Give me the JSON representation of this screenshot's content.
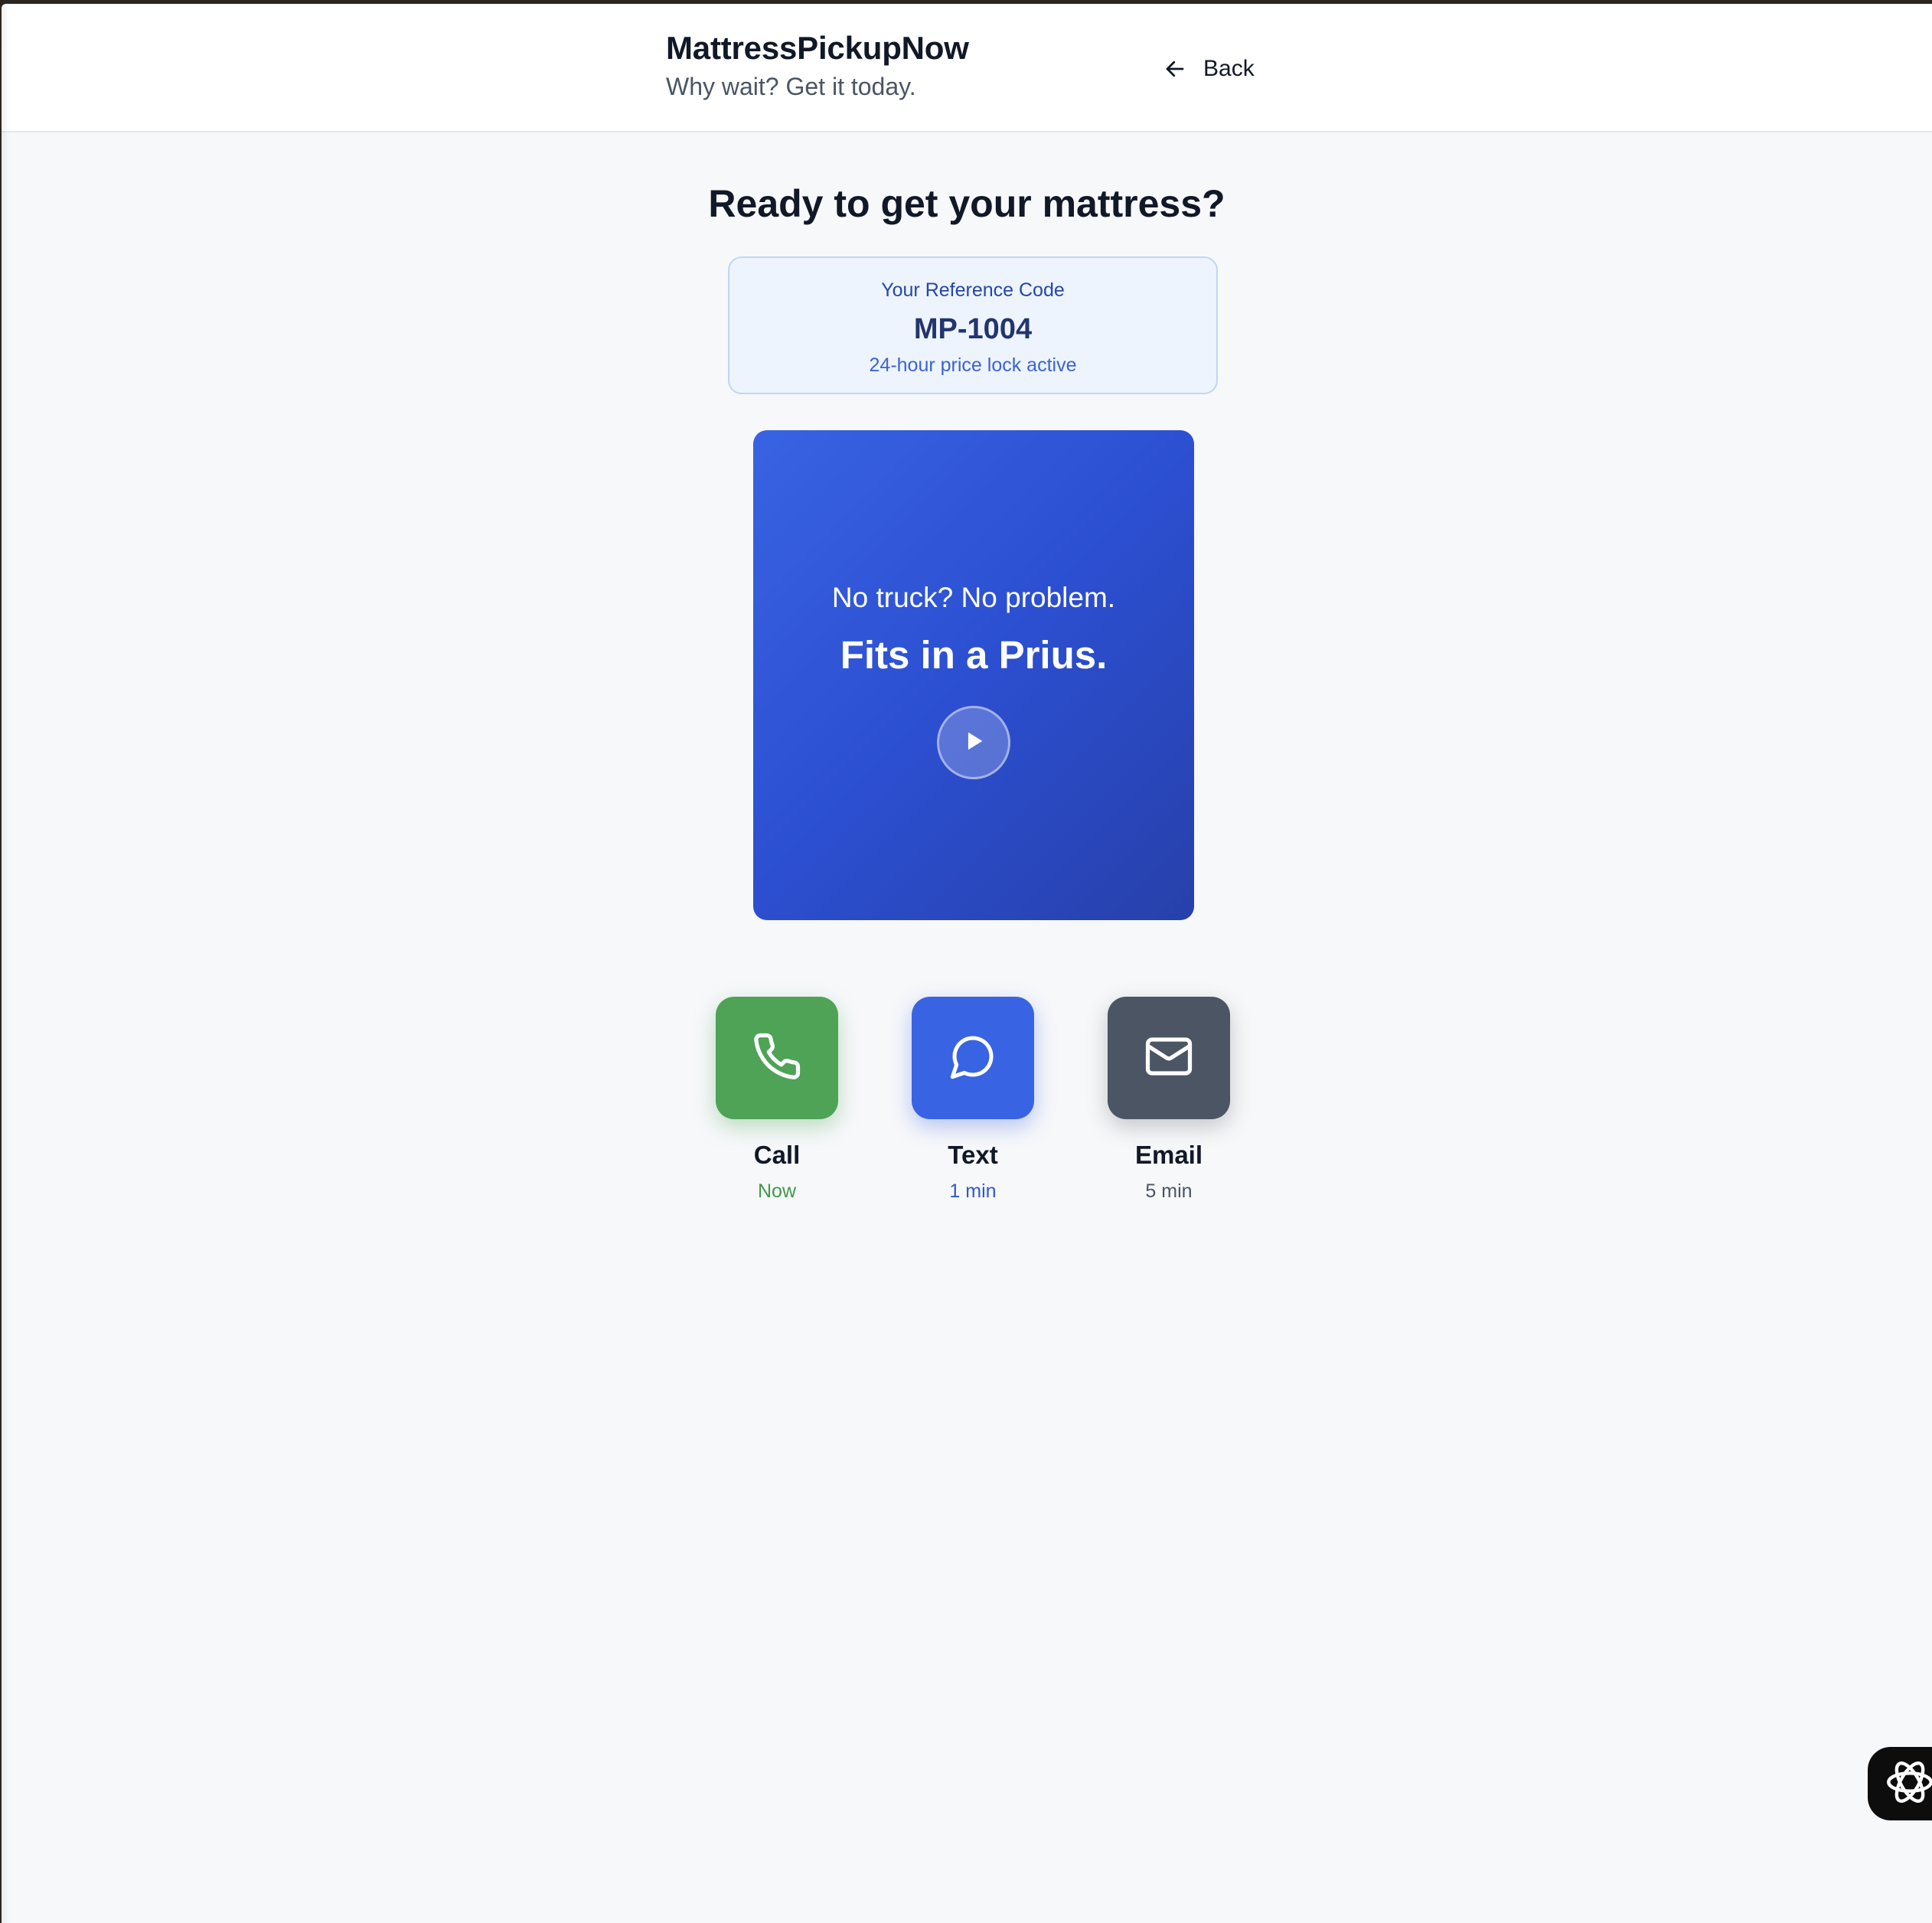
{
  "header": {
    "brand": "MattressPickupNow",
    "tagline": "Why wait? Get it today.",
    "back_label": "Back"
  },
  "main": {
    "title": "Ready to get your mattress?",
    "reference": {
      "label": "Your Reference Code",
      "code": "MP-1004",
      "note": "24-hour price lock active"
    },
    "video": {
      "line1": "No truck? No problem.",
      "line2": "Fits in a Prius.",
      "play_icon": "play-icon"
    },
    "contacts": [
      {
        "label": "Call",
        "eta": "Now",
        "icon": "phone-icon",
        "color": "#4ea356"
      },
      {
        "label": "Text",
        "eta": "1 min",
        "icon": "chat-bubble-icon",
        "color": "#3863e2"
      },
      {
        "label": "Email",
        "eta": "5 min",
        "icon": "mail-icon",
        "color": "#4b5563"
      }
    ]
  },
  "assistant": {
    "icon": "assistant-logo-icon"
  },
  "colors": {
    "background": "#f7f8fa",
    "header_bg": "#ffffff",
    "accent_blue": "#3863e2",
    "ref_card_bg": "#eef4fd"
  }
}
